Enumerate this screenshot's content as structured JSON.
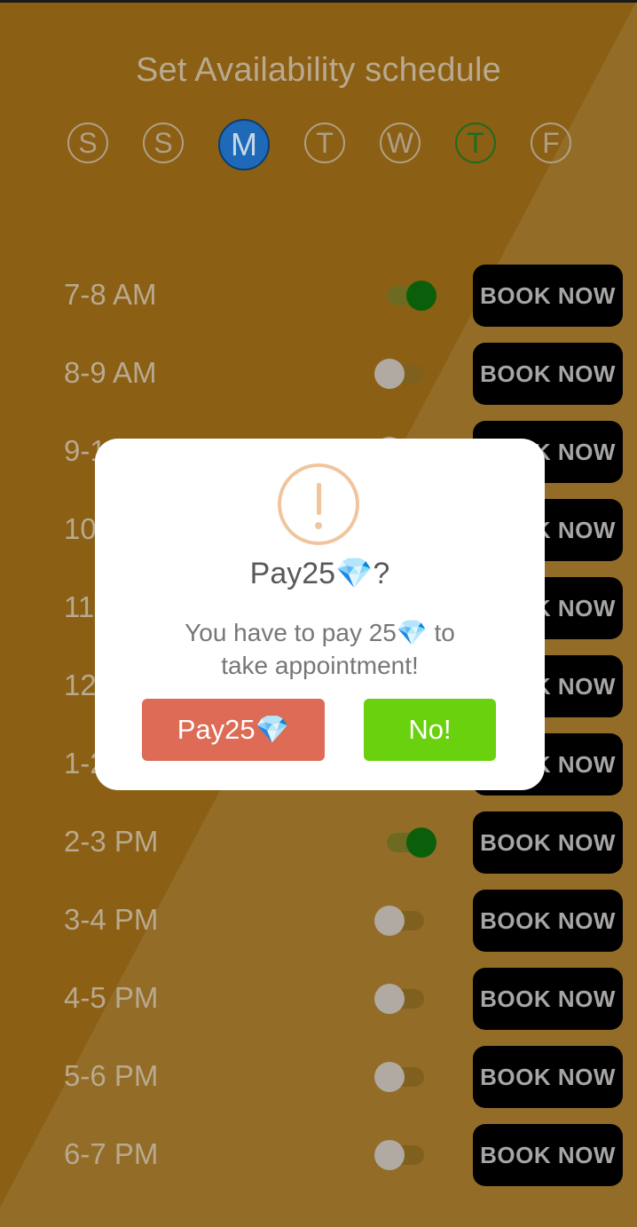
{
  "screen": {
    "title": "Set Availability schedule",
    "days": [
      {
        "letter": "S",
        "state": "normal"
      },
      {
        "letter": "S",
        "state": "normal"
      },
      {
        "letter": "M",
        "state": "selected"
      },
      {
        "letter": "T",
        "state": "normal"
      },
      {
        "letter": "W",
        "state": "normal"
      },
      {
        "letter": "T",
        "state": "today"
      },
      {
        "letter": "F",
        "state": "normal"
      }
    ],
    "book_label": "BOOK NOW",
    "slots": [
      {
        "label": "7-8 AM",
        "toggle": true
      },
      {
        "label": "8-9 AM",
        "toggle": false
      },
      {
        "label": "9-10 AM",
        "toggle": false
      },
      {
        "label": "10-11 AM",
        "toggle": false
      },
      {
        "label": "11-12 PM",
        "toggle": false
      },
      {
        "label": "12-1 PM",
        "toggle": false
      },
      {
        "label": "1-2 PM",
        "toggle": false
      },
      {
        "label": "2-3 PM",
        "toggle": true
      },
      {
        "label": "3-4 PM",
        "toggle": false
      },
      {
        "label": "4-5 PM",
        "toggle": false
      },
      {
        "label": "5-6 PM",
        "toggle": false
      },
      {
        "label": "6-7 PM",
        "toggle": false
      }
    ]
  },
  "dialog": {
    "icon": "warning-icon",
    "title": "Pay25💎?",
    "message_line1": "You have to pay 25💎 to",
    "message_line2": "take appointment!",
    "confirm_label": "Pay25💎",
    "cancel_label": "No!"
  },
  "colors": {
    "background": "#8b5f14",
    "selected_day": "#1e6ab8",
    "toggle_on": "#0b5f0b",
    "confirm_button": "#dd6b55",
    "cancel_button": "#6ad10e",
    "book_button": "#000000"
  }
}
